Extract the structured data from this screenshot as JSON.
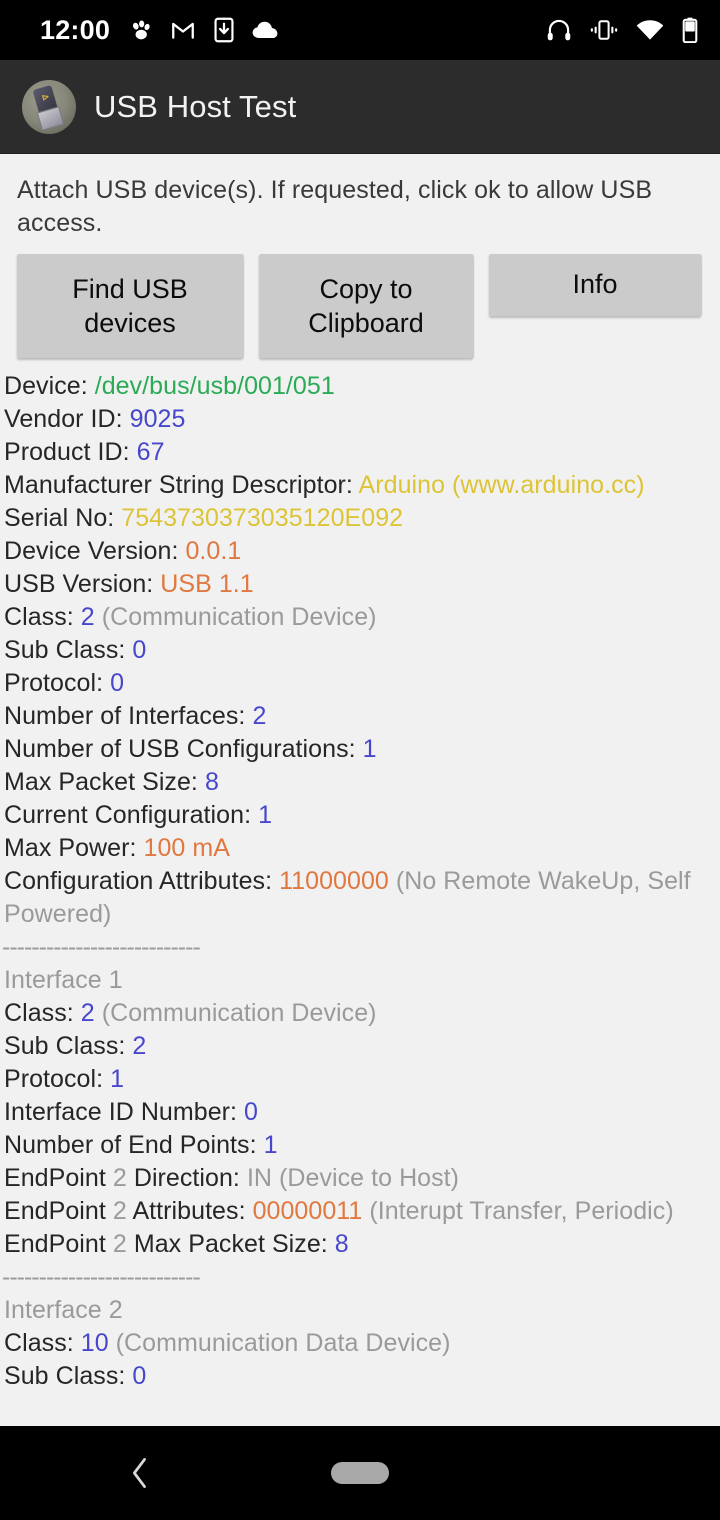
{
  "status_bar": {
    "time": "12:00",
    "left_icons": [
      "paw-icon",
      "gmail-icon",
      "phone-download-icon",
      "cloud-icon"
    ],
    "right_icons": [
      "headphones-icon",
      "vibrate-icon",
      "wifi-icon",
      "battery-icon"
    ],
    "background": "#000000"
  },
  "app_bar": {
    "title": "USB Host Test",
    "icon": "usb-connector-app-icon",
    "background": "#2c2c2c"
  },
  "main": {
    "instructions": "Attach USB device(s).  If requested, click ok to allow USB access.",
    "buttons": [
      {
        "label": "Find USB devices",
        "name": "find-usb-devices-button"
      },
      {
        "label": "Copy to Clipboard",
        "name": "copy-to-clipboard-button"
      },
      {
        "label": "Info",
        "name": "info-button"
      }
    ],
    "separator": "---------------------------",
    "colors": {
      "label": "#262626",
      "green": "#2bab55",
      "blue": "#4747cc",
      "yellow": "#ddc437",
      "orange": "#e0783f",
      "gray": "#9a9a9a",
      "background": "#f1f1f1",
      "button": "#cbcbcb"
    },
    "device_info": [
      {
        "label": "Device: ",
        "value": "/dev/bus/usb/001/051",
        "color": "green",
        "note": ""
      },
      {
        "label": "Vendor ID: ",
        "value": "9025",
        "color": "blue",
        "note": ""
      },
      {
        "label": "Product ID: ",
        "value": "67",
        "color": "blue",
        "note": ""
      },
      {
        "label": "Manufacturer String Descriptor: ",
        "value": "Arduino (www.arduino.cc)",
        "color": "yellow",
        "note": ""
      },
      {
        "label": "Serial No: ",
        "value": "7543730373035120E092",
        "color": "yellow",
        "note": ""
      },
      {
        "label": "Device Version: ",
        "value": "0.0.1",
        "color": "orange",
        "note": ""
      },
      {
        "label": "USB Version: ",
        "value": "USB 1.1",
        "color": "orange",
        "note": ""
      },
      {
        "label": "Class: ",
        "value": "2",
        "color": "blue",
        "note": " (Communication Device)"
      },
      {
        "label": "Sub Class: ",
        "value": "0",
        "color": "blue",
        "note": ""
      },
      {
        "label": "Protocol: ",
        "value": "0",
        "color": "blue",
        "note": ""
      },
      {
        "label": "Number of Interfaces: ",
        "value": "2",
        "color": "blue",
        "note": ""
      },
      {
        "label": "Number of USB Configurations: ",
        "value": "1",
        "color": "blue",
        "note": ""
      },
      {
        "label": "Max Packet Size: ",
        "value": "8",
        "color": "blue",
        "note": ""
      },
      {
        "label": "Current Configuration: ",
        "value": "1",
        "color": "blue",
        "note": ""
      },
      {
        "label": "Max Power: ",
        "value": "100 mA",
        "color": "orange",
        "note": ""
      },
      {
        "label": "Configuration Attributes: ",
        "value": "11000000",
        "color": "orange",
        "note": " (No Remote WakeUp, Self Powered)"
      }
    ],
    "interface_1": {
      "heading": "Interface 1",
      "lines": [
        {
          "label": "Class: ",
          "value": "2",
          "color": "blue",
          "note": " (Communication Device)"
        },
        {
          "label": "Sub Class: ",
          "value": "2",
          "color": "blue",
          "note": ""
        },
        {
          "label": "Protocol: ",
          "value": "1",
          "color": "blue",
          "note": ""
        },
        {
          "label": "Interface ID Number: ",
          "value": "0",
          "color": "blue",
          "note": ""
        },
        {
          "label": "Number of End Points: ",
          "value": "1",
          "color": "blue",
          "note": ""
        }
      ],
      "endpoint_direction": {
        "pre": "EndPoint ",
        "num": "2",
        "mid": " Direction: ",
        "value": "IN",
        "note": " (Device to Host)"
      },
      "endpoint_attributes": {
        "pre": "EndPoint ",
        "num": "2",
        "mid": " Attributes: ",
        "value": "00000011",
        "note": " (Interupt Transfer, Periodic)"
      },
      "endpoint_packet": {
        "pre": "EndPoint ",
        "num": "2",
        "mid": " Max Packet Size: ",
        "value": "8",
        "note": ""
      }
    },
    "interface_2": {
      "heading": "Interface 2",
      "lines": [
        {
          "label": "Class: ",
          "value": "10",
          "color": "blue",
          "note": " (Communication Data Device)"
        },
        {
          "label": "Sub Class: ",
          "value": "0",
          "color": "blue",
          "note": ""
        }
      ]
    }
  },
  "nav_bar": {
    "back": "back-icon",
    "home": "home-pill",
    "background": "#000000"
  }
}
